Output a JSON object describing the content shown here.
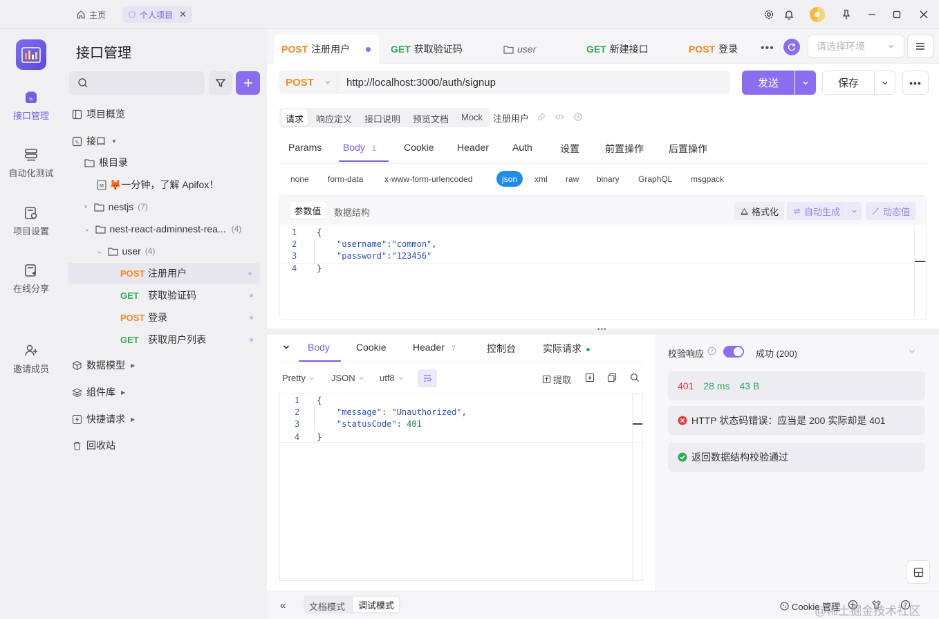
{
  "titlebar": {
    "tabs": [
      {
        "label": "主页"
      },
      {
        "label": "个人项目"
      }
    ]
  },
  "rail": {
    "items": [
      {
        "label": "接口管理"
      },
      {
        "label": "自动化测试"
      },
      {
        "label": "项目设置"
      },
      {
        "label": "在线分享"
      },
      {
        "label": "邀请成员"
      }
    ]
  },
  "sidebar": {
    "title": "接口管理",
    "search_placeholder": "",
    "tree": {
      "overview": "项目概览",
      "api": "接口",
      "root": "根目录",
      "intro": "🦊一分钟，了解 Apifox！",
      "nestjs": "nestjs",
      "nestjs_count": "(7)",
      "nest_react": "nest-react-adminnest-rea...",
      "nest_react_count": "(4)",
      "user": "user",
      "user_count": "(4)",
      "endpoints": [
        {
          "method": "POST",
          "name": "注册用户"
        },
        {
          "method": "GET",
          "name": "获取验证码"
        },
        {
          "method": "POST",
          "name": "登录"
        },
        {
          "method": "GET",
          "name": "获取用户列表"
        }
      ],
      "models": "数据模型",
      "components": "组件库",
      "quick": "快捷请求",
      "trash": "回收站"
    }
  },
  "tabs": [
    {
      "method": "POST",
      "name": "注册用户"
    },
    {
      "method": "GET",
      "name": "获取验证码"
    },
    {
      "method": "",
      "name": "user"
    },
    {
      "method": "GET",
      "name": "新建接口"
    },
    {
      "method": "POST",
      "name": "登录"
    }
  ],
  "env_placeholder": "请选择环境",
  "request": {
    "method": "POST",
    "url": "http://localhost:3000/auth/signup",
    "send": "发送",
    "save": "保存"
  },
  "mode_tabs": [
    "请求",
    "响应定义",
    "接口说明",
    "预览文档",
    "Mock"
  ],
  "api_name": "注册用户",
  "param_tabs": [
    "Params",
    "Body",
    "Cookie",
    "Header",
    "Auth",
    "设置",
    "前置操作",
    "后置操作"
  ],
  "body_count": "1",
  "body_types": [
    "none",
    "form-data",
    "x-www-form-urlencoded",
    "json",
    "xml",
    "raw",
    "binary",
    "GraphQL",
    "msgpack"
  ],
  "body_editor": {
    "tabs": [
      "参数值",
      "数据结构"
    ],
    "format": "格式化",
    "auto_gen": "自动生成",
    "dynamic": "动态值",
    "lines": [
      {
        "n": "1",
        "text": "{"
      },
      {
        "n": "2",
        "key": "\"username\"",
        "val": "\"common\"",
        "tail": ","
      },
      {
        "n": "3",
        "key": "\"password\"",
        "val": "\"123456\"",
        "tail": ""
      },
      {
        "n": "4",
        "text": "}"
      }
    ]
  },
  "response": {
    "tabs": [
      "Body",
      "Cookie",
      "Header",
      "控制台",
      "实际请求"
    ],
    "header_count": "7",
    "toolbar": [
      "Pretty",
      "JSON",
      "utf8"
    ],
    "extract": "提取",
    "lines": [
      {
        "n": "1",
        "text": "{"
      },
      {
        "n": "2",
        "key": "\"message\"",
        "val": "\"Unauthorized\"",
        "tail": ","
      },
      {
        "n": "3",
        "key": "\"statusCode\"",
        "val": "401",
        "tail": ""
      },
      {
        "n": "4",
        "text": "}"
      }
    ]
  },
  "validation": {
    "label": "校验响应",
    "status": "成功 (200)",
    "code": "401",
    "time": "28 ms",
    "size": "43 B",
    "error": "HTTP 状态码错误：应当是 200 实际却是 401",
    "ok": "返回数据结构校验通过"
  },
  "bottom": {
    "doc_mode": "文档模式",
    "debug_mode": "调试模式",
    "cookie": "Cookie 管理",
    "watermark": "@稀土掘金技术社区"
  },
  "colors": {
    "accent": "#7b5ce0",
    "post": "#f08a24",
    "get": "#2faa5a",
    "error": "#e03a3a",
    "success": "#2faa5a"
  }
}
